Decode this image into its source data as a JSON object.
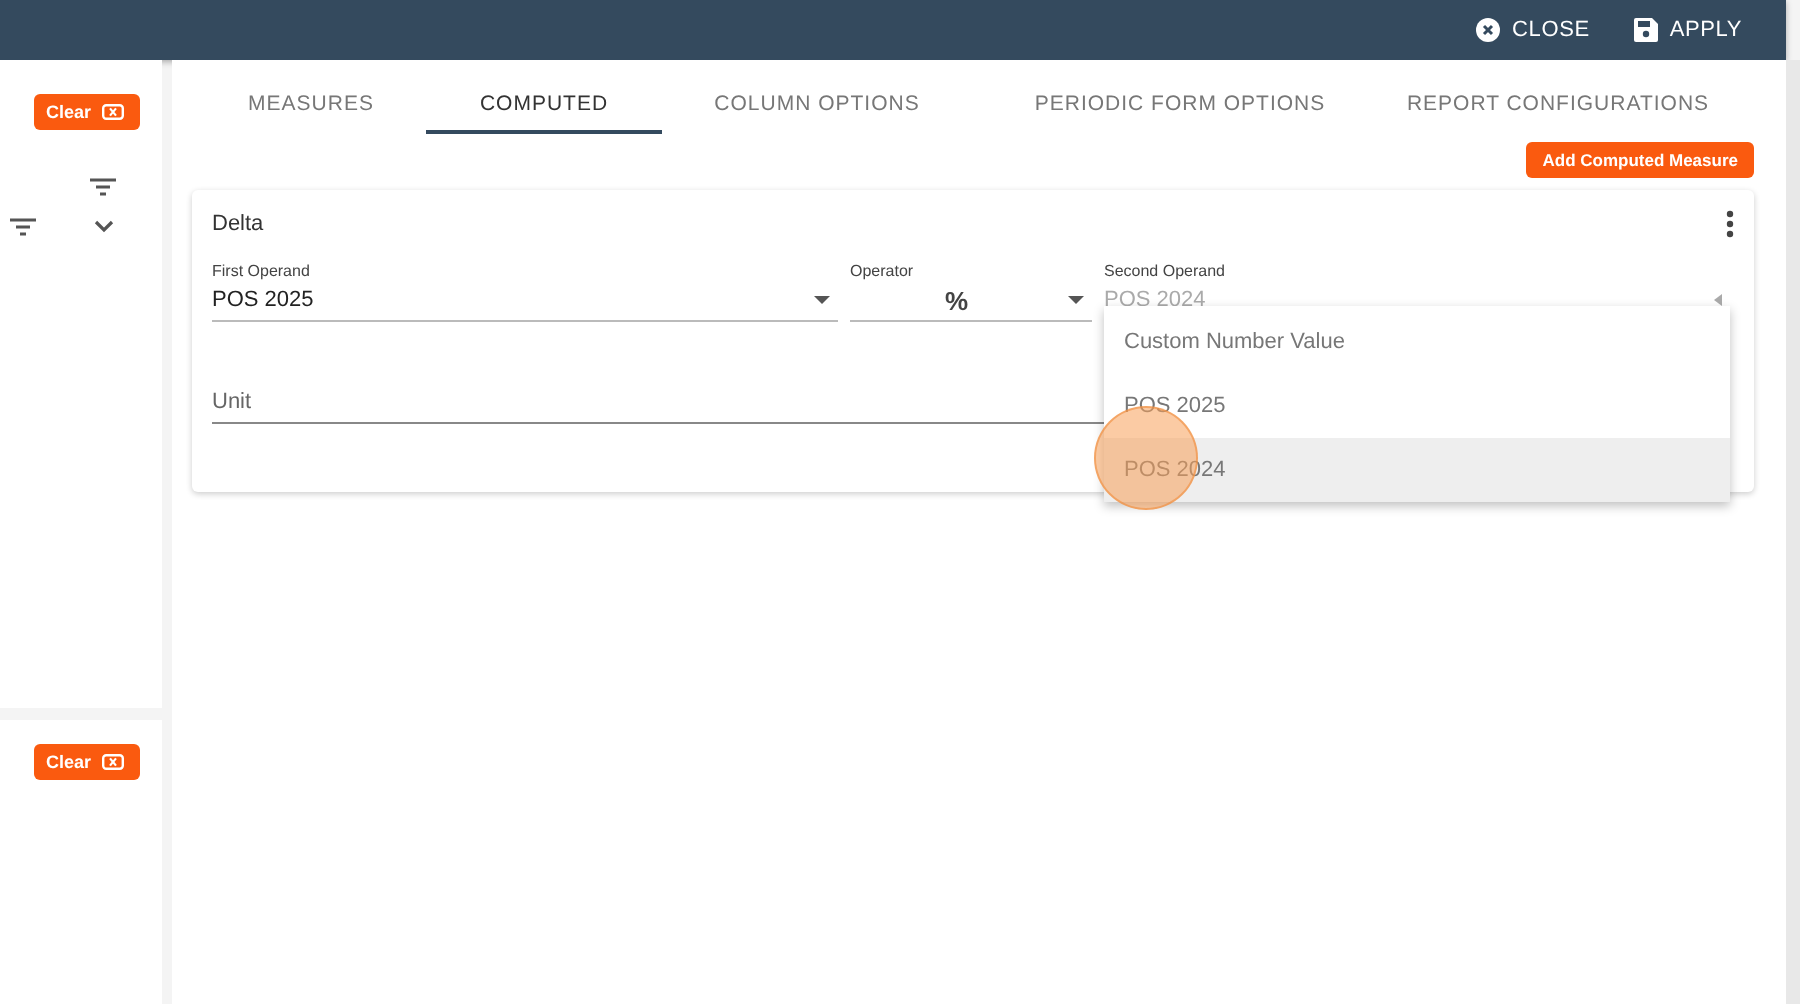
{
  "header": {
    "buttons": [
      {
        "label": "CLOSE",
        "kind": "close"
      },
      {
        "label": "APPLY",
        "kind": "save"
      }
    ]
  },
  "sidebar": {
    "sections": [
      {
        "clear_label": "Clear",
        "filters": true
      },
      {
        "clear_label": "Clear",
        "filters": false
      }
    ]
  },
  "tabs": [
    {
      "label": "MEASURES",
      "selected": false
    },
    {
      "label": "COMPUTED",
      "selected": true
    },
    {
      "label": "COLUMN OPTIONS",
      "selected": false
    },
    {
      "label": "PERIODIC FORM OPTIONS",
      "selected": false
    },
    {
      "label": "REPORT CONFIGURATIONS",
      "selected": false
    }
  ],
  "add_button": "Add Computed Measure",
  "card": {
    "title": "Delta",
    "first_operand": {
      "label": "First Operand",
      "value": "POS 2025"
    },
    "operator": {
      "label": "Operator",
      "value": "%"
    },
    "second_operand": {
      "label": "Second Operand",
      "value": "POS 2024",
      "expanded": true,
      "options": [
        {
          "label": "Custom Number Value",
          "selected": false
        },
        {
          "label": "POS 2025",
          "selected": false
        },
        {
          "label": "POS 2024",
          "selected": true
        }
      ]
    },
    "unit": {
      "placeholder": "Unit"
    }
  }
}
